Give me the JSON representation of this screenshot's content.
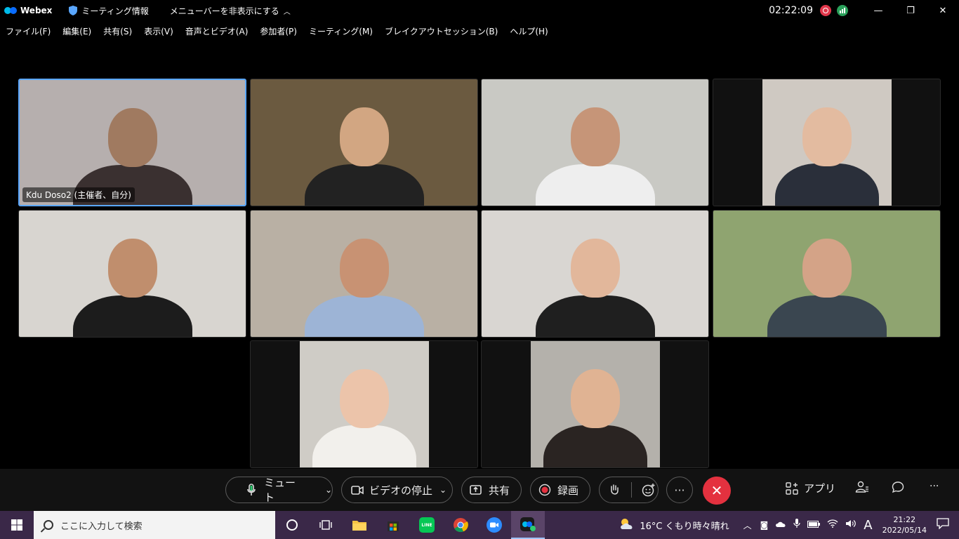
{
  "titlebar": {
    "app_name": "Webex",
    "meeting_info": "ミーティング情報",
    "hide_menu": "メニューバーを非表示にする",
    "clock": "02:22:09"
  },
  "menu": [
    "ファイル(F)",
    "編集(E)",
    "共有(S)",
    "表示(V)",
    "音声とビデオ(A)",
    "参加者(P)",
    "ミーティング(M)",
    "ブレイクアウトセッション(B)",
    "ヘルプ(H)"
  ],
  "tiles": [
    {
      "name": "Kdu Doso2 (主催者、自分)",
      "bg": "#b6afae",
      "skin": "#a07a60",
      "shirt": "#3a3030"
    },
    {
      "name": "",
      "bg": "#6b5a40",
      "skin": "#d2a682",
      "shirt": "#222222"
    },
    {
      "name": "",
      "bg": "#c9c9c4",
      "skin": "#c69578",
      "shirt": "#eeeeee"
    },
    {
      "name": "",
      "bg": "#cfc9c2",
      "skin": "#e3bba0",
      "shirt": "#2a2f3a"
    },
    {
      "name": "",
      "bg": "#d8d5d0",
      "skin": "#c08e6d",
      "shirt": "#1c1c1c"
    },
    {
      "name": "",
      "bg": "#b9b0a4",
      "skin": "#c89273",
      "shirt": "#9db4d6"
    },
    {
      "name": "",
      "bg": "#d9d6d2",
      "skin": "#e2b79b",
      "shirt": "#1f1f1f"
    },
    {
      "name": "",
      "bg": "#8fa470",
      "skin": "#d4a387",
      "shirt": "#3a4650"
    },
    {
      "name": "",
      "bg": "#cfccc6",
      "skin": "#ecc4aa",
      "shirt": "#f2f0ec"
    },
    {
      "name": "",
      "bg": "#b4b1ab",
      "skin": "#e0b393",
      "shirt": "#2a2422"
    }
  ],
  "controls": {
    "mute_label": "ミュート",
    "video_label": "ビデオの停止",
    "share_label": "共有",
    "record_label": "録画",
    "apps_label": "アプリ",
    "end_color": "#e4313f"
  },
  "taskbar": {
    "search_placeholder": "ここに入力して検索",
    "weather": "16°C くもり時々晴れ",
    "ime": "A",
    "time": "21:22",
    "date": "2022/05/14"
  }
}
